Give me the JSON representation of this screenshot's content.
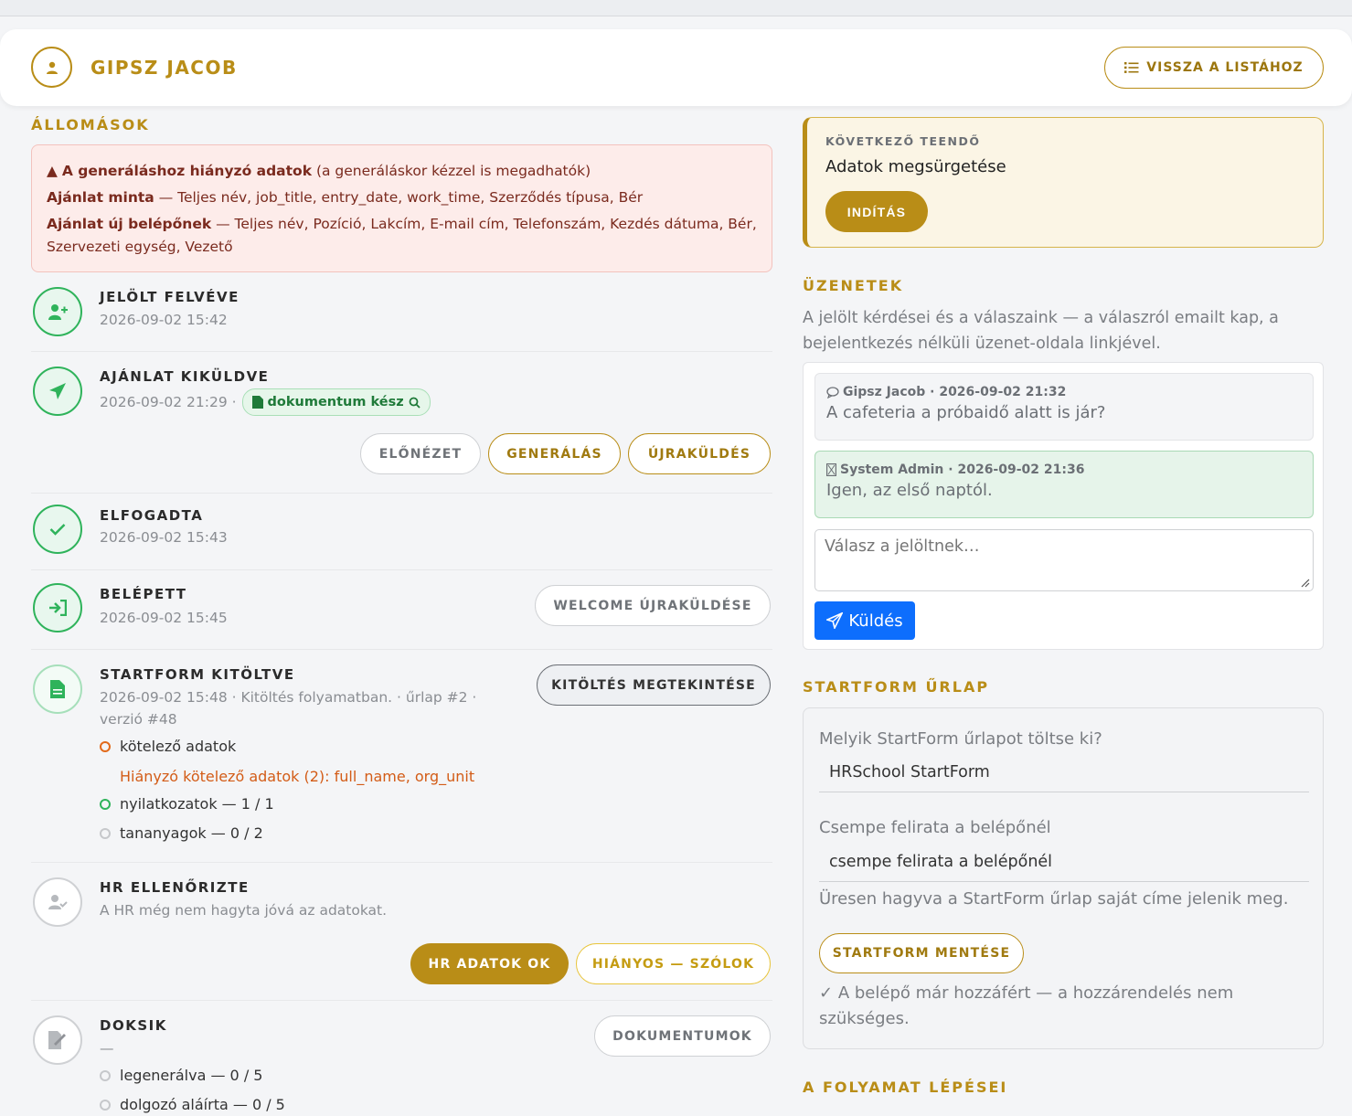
{
  "browser": {
    "url_fragment": "p) / onboarding / 'a/pel 2025"
  },
  "header": {
    "candidate_name": "GIPSZ JACOB",
    "back_label": "VISSZA A LISTÁHOZ"
  },
  "stations": {
    "section_title": "ÁLLOMÁSOK",
    "alert": {
      "headline": "A generáláshoz hiányzó adatok",
      "headline_note": "(a generáláskor kézzel is megadhatók)",
      "lines": [
        {
          "name": "Ajánlat minta",
          "fields": "— Teljes név, job_title, entry_date, work_time, Szerződés típusa, Bér"
        },
        {
          "name": "Ajánlat új belépőnek",
          "fields": "— Teljes név, Pozíció, Lakcím, E-mail cím, Telefonszám, Kezdés dátuma, Bér, Szervezeti egység, Vezető"
        }
      ]
    },
    "steps": [
      {
        "title": "JELÖLT FELVÉVE",
        "date": "2026-09-02 15:42"
      },
      {
        "title": "AJÁNLAT KIKÜLDVE",
        "date": "2026-09-02 21:29 ·",
        "badge": "dokumentum kész",
        "buttons": [
          "ELŐNÉZET",
          "GENERÁLÁS",
          "ÚJRAKÜLDÉS"
        ]
      },
      {
        "title": "ELFOGADTA",
        "date": "2026-09-02 15:43"
      },
      {
        "title": "BELÉPETT",
        "date": "2026-09-02 15:45",
        "button": "WELCOME ÚJRAKÜLDÉSE"
      },
      {
        "title": "STARTFORM KITÖLTVE",
        "detail_line1": "2026-09-02 15:48 · Kitöltés folyamatban. · űrlap #2 ·",
        "detail_line2": "verzió #48",
        "button": "KITÖLTÉS MEGTEKINTÉSE",
        "items": [
          {
            "label": "kötelező adatok",
            "state": "orange"
          },
          {
            "label": "nyilatkozatok — 1 / 1",
            "state": "green"
          },
          {
            "label": "tananyagok — 0 / 2",
            "state": "gray"
          }
        ],
        "missing": "Hiányzó kötelező adatok (2): full_name, org_unit"
      },
      {
        "title": "HR ELLENŐRIZTE",
        "note": "A HR még nem hagyta jóvá az adatokat.",
        "buttons": [
          "HR ADATOK OK",
          "HIÁNYOS — SZÓLOK"
        ]
      },
      {
        "title": "DOKSIK",
        "dash": "—",
        "button": "DOKUMENTUMOK",
        "items": [
          {
            "label": "legenerálva — 0 / 5",
            "state": "gray"
          },
          {
            "label": "dolgozó aláírta — 0 / 5",
            "state": "gray"
          }
        ]
      }
    ]
  },
  "next_task": {
    "label": "KÖVETKEZŐ TEENDŐ",
    "title": "Adatok megsürgetése",
    "button": "INDÍTÁS"
  },
  "messages": {
    "section_title": "ÜZENETEK",
    "intro": "A jelölt kérdései és a válaszaink — a válaszról emailt kap, a bejelentkezés nélküli üzenet-oldala linkjével.",
    "thread": [
      {
        "meta": "Gipsz Jacob · 2026-09-02 21:32",
        "text": "A cafeteria a próbaidő alatt is jár?"
      },
      {
        "meta": "System Admin · 2026-09-02 21:36",
        "text": "Igen, az első naptól."
      }
    ],
    "reply_placeholder": "Válasz a jelöltnek…",
    "send_label": "Küldés"
  },
  "startform": {
    "section_title": "STARTFORM ŰRLAP",
    "form_question": "Melyik StartForm űrlapot töltse ki?",
    "form_value": "HRSchool StartForm",
    "tile_label": "Csempe felirata a belépőnél",
    "tile_placeholder": "csempe felirata a belépőnél",
    "tile_hint": "Üresen hagyva a StartForm űrlap saját címe jelenik meg.",
    "save_label": "STARTFORM MENTÉSE",
    "note": "A belépő már hozzáfért — a hozzárendelés nem szükséges."
  },
  "process": {
    "section_title": "A FOLYAMAT LÉPÉSEI"
  },
  "colors": {
    "gold": "#b98d17",
    "green": "#2fb35b",
    "blue": "#0d6efd",
    "orange": "#d35c17"
  }
}
